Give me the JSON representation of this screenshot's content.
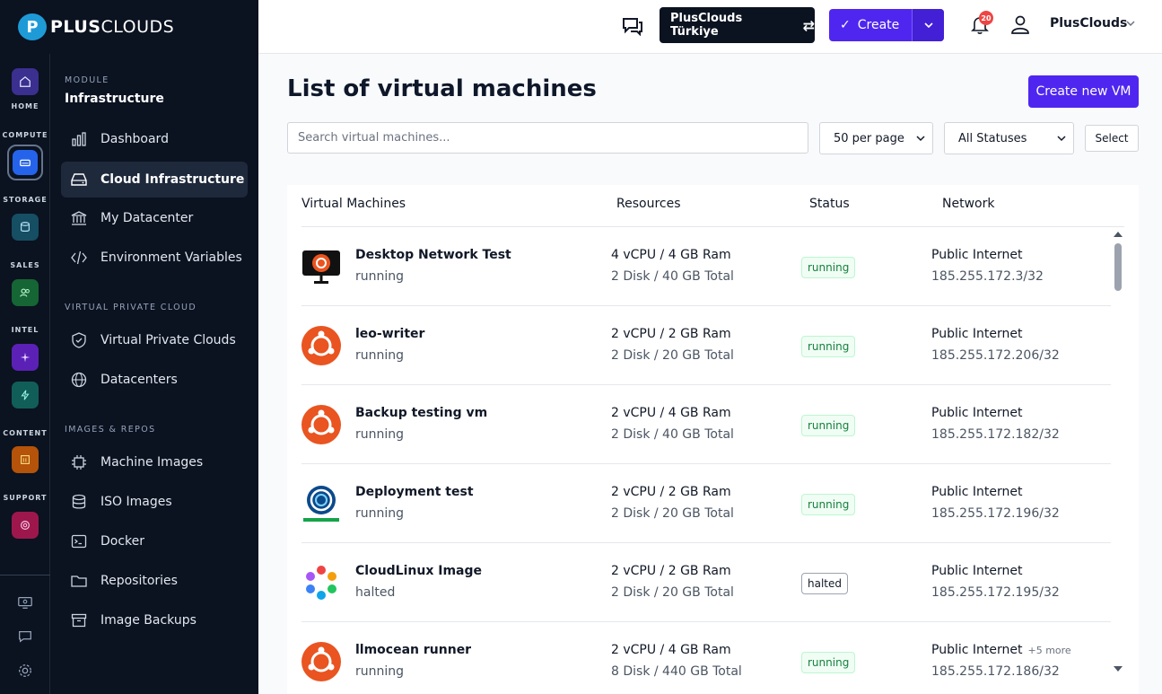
{
  "brand": {
    "logo_mark": "P",
    "name_bold": "PLUS",
    "name_light": "CLOUDS"
  },
  "rail": {
    "home": "HOME",
    "compute": "COMPUTE",
    "storage": "STORAGE",
    "sales": "SALES",
    "intel": "INTEL",
    "content": "CONTENT",
    "support": "SUPPORT"
  },
  "module": {
    "label": "MODULE",
    "title": "Infrastructure",
    "items": [
      {
        "label": "Dashboard"
      },
      {
        "label": "Cloud Infrastructure"
      },
      {
        "label": "My Datacenter"
      },
      {
        "label": "Environment Variables"
      }
    ],
    "vpc_label": "VIRTUAL PRIVATE CLOUD",
    "vpc_items": [
      {
        "label": "Virtual Private Clouds"
      },
      {
        "label": "Datacenters"
      }
    ],
    "images_label": "IMAGES & REPOS",
    "images_items": [
      {
        "label": "Machine Images"
      },
      {
        "label": "ISO Images"
      },
      {
        "label": "Docker"
      },
      {
        "label": "Repositories"
      },
      {
        "label": "Image Backups"
      }
    ]
  },
  "header": {
    "org": "PlusClouds Türkiye",
    "create": "Create",
    "notifications": "20",
    "user": "PlusClouds"
  },
  "page": {
    "title": "List of virtual machines",
    "create_vm": "Create new VM",
    "search_placeholder": "Search virtual machines...",
    "per_page": "50 per page",
    "status_filter": "All Statuses",
    "select": "Select"
  },
  "table": {
    "headers": [
      "Virtual Machines",
      "Resources",
      "Status",
      "Network"
    ],
    "rows": [
      {
        "name": "Desktop Network Test",
        "state": "running",
        "cpu": "4 vCPU / 4 GB Ram",
        "disk": "2 Disk / 40 GB Total",
        "status": "running",
        "net": "Public Internet",
        "more": "",
        "ip": "185.255.172.3/32",
        "icon": "ubuntu-desktop-icon"
      },
      {
        "name": "leo-writer",
        "state": "running",
        "cpu": "2 vCPU / 2 GB Ram",
        "disk": "2 Disk / 20 GB Total",
        "status": "running",
        "net": "Public Internet",
        "more": "",
        "ip": "185.255.172.206/32",
        "icon": "ubuntu-icon"
      },
      {
        "name": "Backup testing vm",
        "state": "running",
        "cpu": "2 vCPU / 4 GB Ram",
        "disk": "2 Disk / 40 GB Total",
        "status": "running",
        "net": "Public Internet",
        "more": "",
        "ip": "185.255.172.182/32",
        "icon": "ubuntu-icon"
      },
      {
        "name": "Deployment test",
        "state": "running",
        "cpu": "2 vCPU / 2 GB Ram",
        "disk": "2 Disk / 20 GB Total",
        "status": "running",
        "net": "Public Internet",
        "more": "",
        "ip": "185.255.172.196/32",
        "icon": "virtualmin-icon"
      },
      {
        "name": "CloudLinux Image",
        "state": "halted",
        "cpu": "2 vCPU / 2 GB Ram",
        "disk": "2 Disk / 20 GB Total",
        "status": "halted",
        "net": "Public Internet",
        "more": "",
        "ip": "185.255.172.195/32",
        "icon": "cloudlinux-icon"
      },
      {
        "name": "llmocean runner",
        "state": "running",
        "cpu": "2 vCPU / 4 GB Ram",
        "disk": "8 Disk / 440 GB Total",
        "status": "running",
        "net": "Public Internet",
        "more": "+5 more",
        "ip": "185.255.172.186/32",
        "icon": "ubuntu-icon"
      }
    ]
  },
  "colors": {
    "sidebar": "#0b1220",
    "accent": "#4f26f0",
    "running": "#15803d"
  }
}
